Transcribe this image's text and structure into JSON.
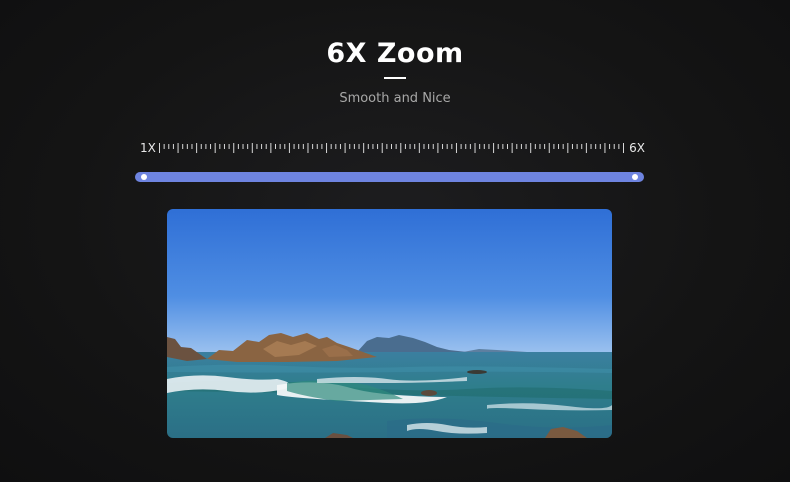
{
  "header": {
    "title": "6X Zoom",
    "subtitle": "Smooth and Nice"
  },
  "zoom": {
    "min_label": "1X",
    "max_label": "6X",
    "min": 1,
    "max": 6,
    "range_start": 1,
    "range_end": 6
  },
  "colors": {
    "background": "#151515",
    "accent": "#6e84e0",
    "title": "#ffffff",
    "subtitle": "#a8a8a8"
  },
  "icons": {
    "range_handle": "circle-handle"
  }
}
